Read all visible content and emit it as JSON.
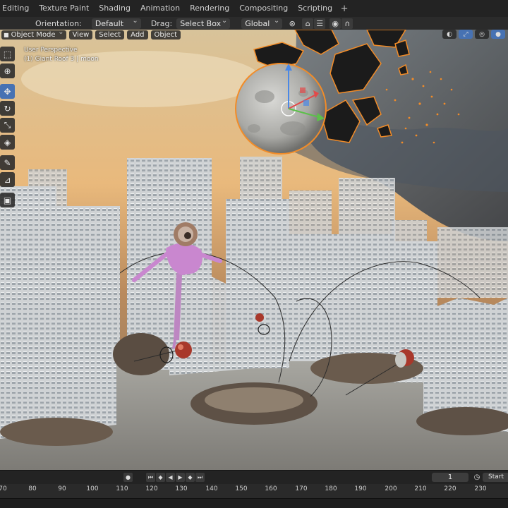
{
  "workspace_tabs": [
    "Editing",
    "Texture Paint",
    "Shading",
    "Animation",
    "Rendering",
    "Compositing",
    "Scripting"
  ],
  "add_tab_glyph": "+",
  "header": {
    "orientation_label": "Orientation:",
    "orientation_value": "Default",
    "drag_label": "Drag:",
    "drag_value": "Select Box",
    "transform_space": "Global"
  },
  "viewport": {
    "mode": "Object Mode",
    "menus": [
      "View",
      "Select",
      "Add",
      "Object"
    ],
    "perspective": "User Perspective",
    "active_object": "(1) Giant Roof 3 | moon"
  },
  "toolbar_icons": [
    "select-box-icon",
    "cursor-icon",
    "move-icon",
    "rotate-icon",
    "scale-icon",
    "transform-icon",
    "annotate-icon",
    "measure-icon",
    "add-cube-icon"
  ],
  "timeline": {
    "current_frame": "1",
    "start_label": "Start"
  },
  "ruler_ticks": [
    "70",
    "80",
    "90",
    "100",
    "110",
    "120",
    "130",
    "140",
    "150",
    "160",
    "170",
    "180",
    "190",
    "200",
    "210",
    "220",
    "230"
  ],
  "colors": {
    "accent": "#4772b3",
    "selection_outline": "#f28c28",
    "header_bg": "#2b2b2b",
    "tab_bg": "#232323"
  }
}
